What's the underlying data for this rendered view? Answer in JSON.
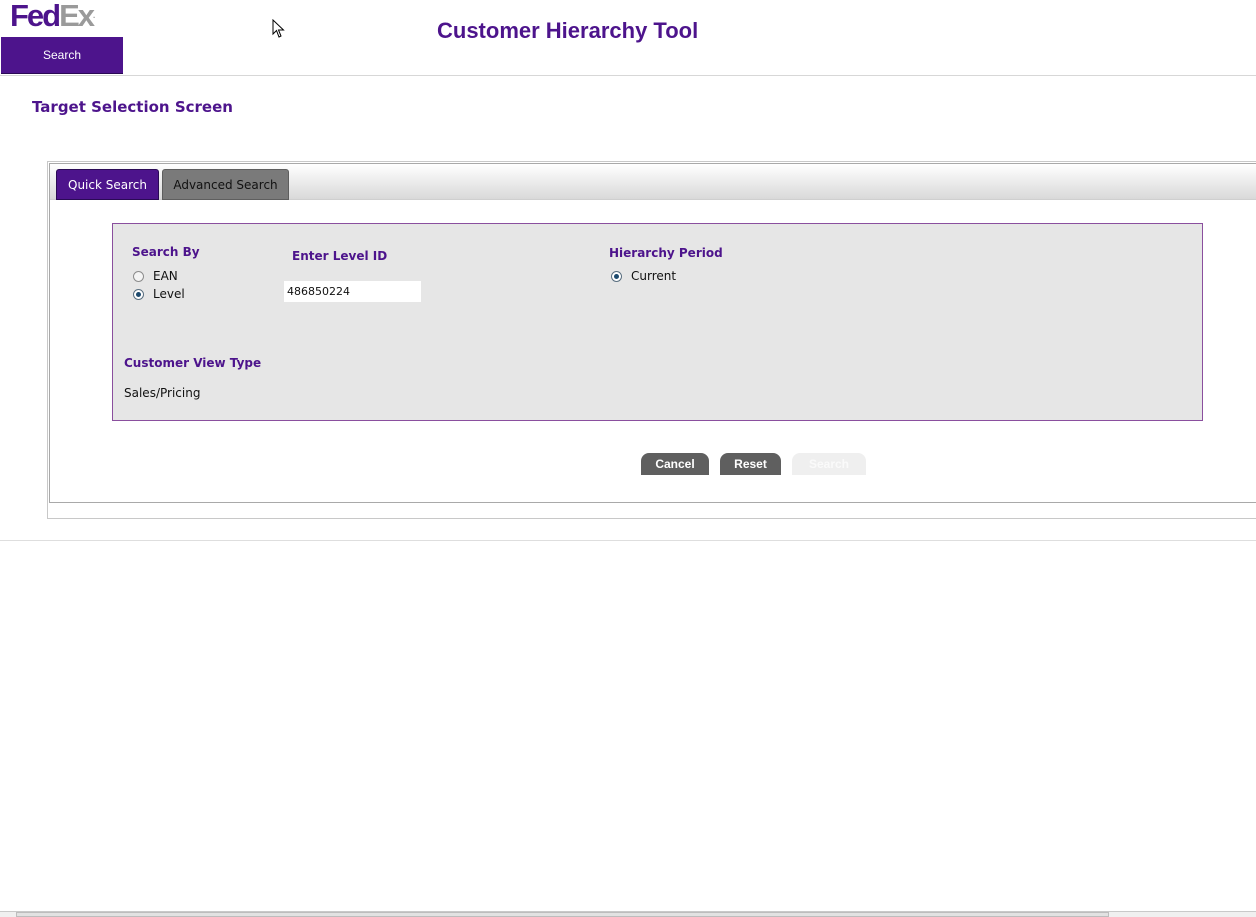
{
  "header": {
    "logo": {
      "fed": "Fed",
      "ex": "Ex",
      "mark": "."
    },
    "nav_search_label": "Search",
    "app_title": "Customer Hierarchy Tool"
  },
  "screen_title": "Target Selection Screen",
  "tabs": [
    {
      "label": "Quick Search",
      "active": true
    },
    {
      "label": "Advanced Search",
      "active": false
    }
  ],
  "form": {
    "search_by": {
      "label": "Search By",
      "options": [
        {
          "label": "EAN",
          "selected": false
        },
        {
          "label": "Level",
          "selected": true
        }
      ]
    },
    "level_id": {
      "label": "Enter Level ID",
      "value": "486850224"
    },
    "hierarchy_period": {
      "label": "Hierarchy Period",
      "options": [
        {
          "label": "Current",
          "selected": true
        }
      ]
    },
    "customer_view_type": {
      "label": "Customer View Type",
      "value": "Sales/Pricing"
    }
  },
  "buttons": {
    "cancel": "Cancel",
    "reset": "Reset",
    "search": "Search"
  },
  "icons": {
    "cursor": "mouse-pointer-icon"
  },
  "colors": {
    "brand_purple": "#4d148c",
    "brand_gray": "#9a9a9a",
    "button_gray": "#5f5f5f"
  }
}
